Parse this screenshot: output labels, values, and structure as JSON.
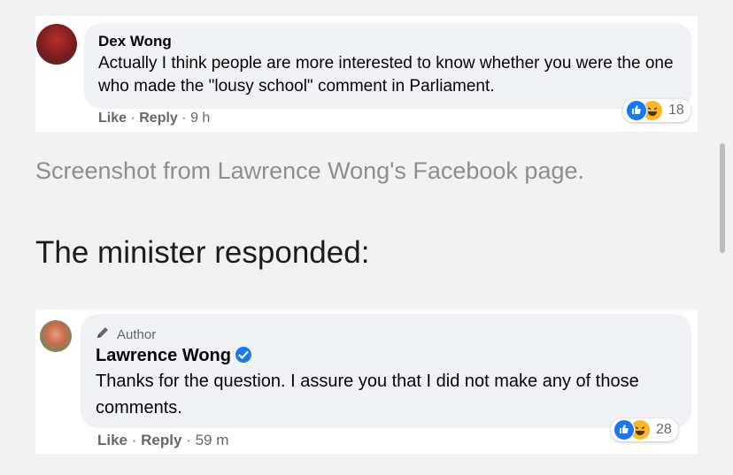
{
  "comment1": {
    "author": "Dex Wong",
    "text": "Actually I think people are more interested to know whether you were the one who made the \"lousy school\" comment in Parliament.",
    "like_label": "Like",
    "reply_label": "Reply",
    "time": "9 h",
    "reaction_count": "18"
  },
  "caption": "Screenshot from Lawrence Wong's Facebook page.",
  "heading": "The minister responded:",
  "comment2": {
    "badge": "Author",
    "author": "Lawrence Wong",
    "text": "Thanks for the question. I assure you that I did not make any of those comments.",
    "like_label": "Like",
    "reply_label": "Reply",
    "time": "59 m",
    "reaction_count": "28"
  },
  "colors": {
    "like_blue": "#1877f2",
    "haha_yellow": "#f7b928",
    "bubble_bg": "#f0f2f5",
    "meta_gray": "#65676b"
  }
}
